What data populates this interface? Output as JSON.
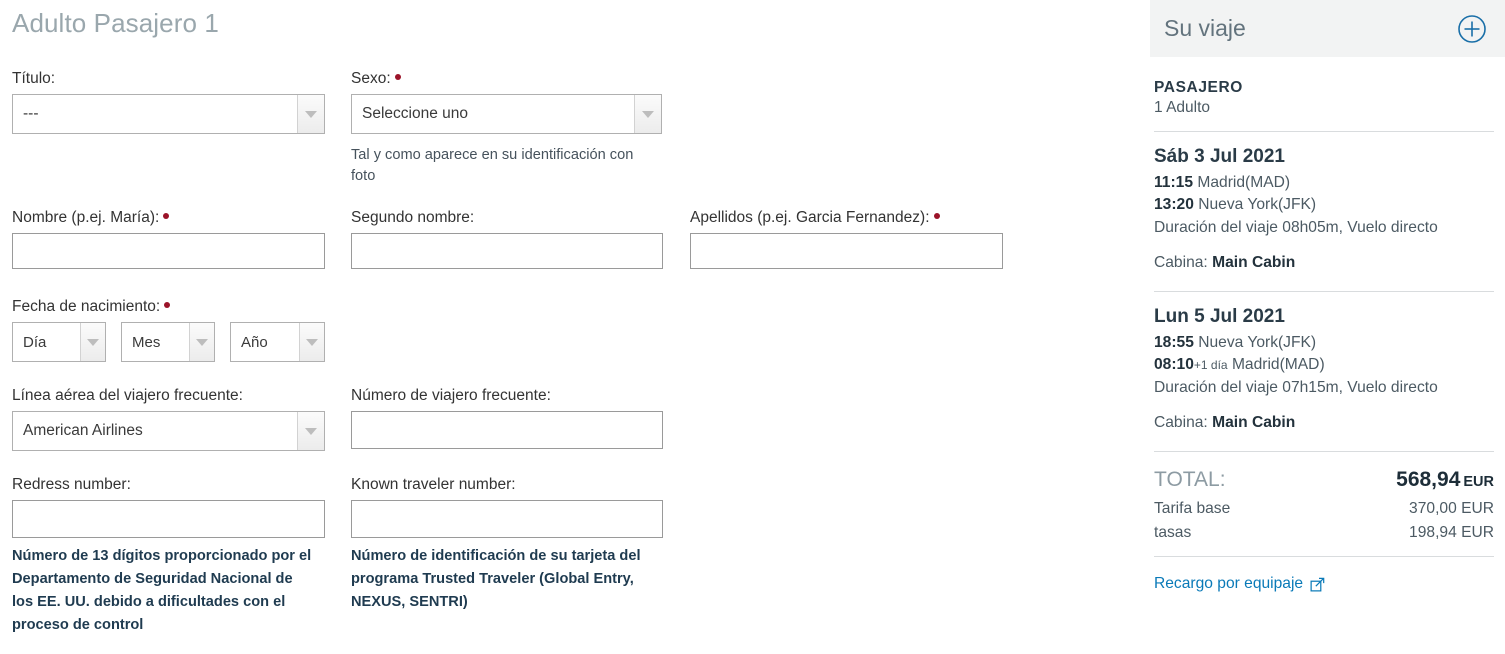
{
  "form": {
    "title": "Adulto Pasajero 1",
    "fields": {
      "titulo": {
        "label": "Título:",
        "value": "---"
      },
      "sexo": {
        "label": "Sexo:",
        "value": "Seleccione uno",
        "helper": "Tal y como aparece en su identificación con foto"
      },
      "nombre": {
        "label": "Nombre (p.ej. María):",
        "value": ""
      },
      "segundo_nombre": {
        "label": "Segundo nombre:",
        "value": ""
      },
      "apellidos": {
        "label": "Apellidos (p.ej. Garcia Fernandez):",
        "value": ""
      },
      "fecha_nacimiento": {
        "label": "Fecha de nacimiento:",
        "dia": "Día",
        "mes": "Mes",
        "anio": "Año"
      },
      "linea_aerea": {
        "label": "Línea aérea del viajero frecuente:",
        "value": "American Airlines"
      },
      "numero_viajero": {
        "label": "Número de viajero frecuente:",
        "value": ""
      },
      "redress": {
        "label": "Redress number:",
        "value": "",
        "helper": "Número de 13 dígitos proporcionado por el Departamento de Seguridad Nacional de los EE. UU. debido a dificultades con el proceso de control"
      },
      "known_traveler": {
        "label": "Known traveler number:",
        "value": "",
        "helper": "Número de identificación de su tarjeta del programa Trusted Traveler (Global Entry, NEXUS, SENTRI)"
      }
    }
  },
  "sidebar": {
    "title": "Su viaje",
    "expand_icon": "circle-plus-icon",
    "passenger": {
      "label": "PASAJERO",
      "detail": "1 Adulto"
    },
    "segments": [
      {
        "date": "Sáb 3 Jul 2021",
        "depart_time": "11:15",
        "depart_place": "Madrid(MAD)",
        "arrive_time": "13:20",
        "arrive_plusday": "",
        "arrive_place": "Nueva York(JFK)",
        "duration": "Duración del viaje 08h05m, Vuelo directo",
        "cabin_label": "Cabina:",
        "cabin_value": "Main Cabin"
      },
      {
        "date": "Lun 5 Jul 2021",
        "depart_time": "18:55",
        "depart_place": "Nueva York(JFK)",
        "arrive_time": "08:10",
        "arrive_plusday": "+1 día",
        "arrive_place": "Madrid(MAD)",
        "duration": "Duración del viaje 07h15m, Vuelo directo",
        "cabin_label": "Cabina:",
        "cabin_value": "Main Cabin"
      }
    ],
    "total": {
      "label": "TOTAL:",
      "amount": "568,94",
      "currency": "EUR"
    },
    "fees": [
      {
        "label": "Tarifa base",
        "amount": "370,00 EUR"
      },
      {
        "label": "tasas",
        "amount": "198,94 EUR"
      }
    ],
    "baggage_link": {
      "label": "Recargo por equipaje",
      "icon": "external-link-icon"
    }
  },
  "colors": {
    "title_gray": "#9aa7ad",
    "required_red": "#9b1329",
    "link_blue": "#0a7ab8",
    "header_bg": "#f2f3f3",
    "text_dark": "#2a3b47"
  }
}
